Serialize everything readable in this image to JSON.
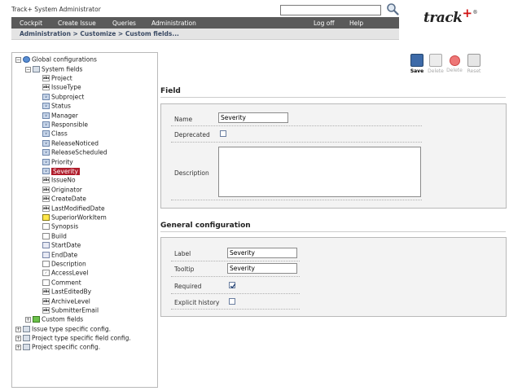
{
  "header": {
    "user_line": "Track+ System Administrator",
    "search": {
      "value": "",
      "placeholder": ""
    },
    "logo_text": "track",
    "logo_plus": "+",
    "logo_reg": "®"
  },
  "menu": {
    "items": [
      "Cockpit",
      "Create Issue",
      "Queries",
      "Administration",
      "Log off",
      "Help"
    ]
  },
  "breadcrumb": "Administration  >  Customize  >  Custom fields...",
  "toolbar": {
    "buttons": [
      {
        "label": "Save",
        "enabled": true
      },
      {
        "label": "Delete",
        "enabled": false
      },
      {
        "label": "Delete",
        "enabled": false
      },
      {
        "label": "Reset",
        "enabled": false
      }
    ]
  },
  "tree": {
    "root": "Global configurations",
    "system_fields": "System fields",
    "items": [
      {
        "label": "Project",
        "icon": "abc"
      },
      {
        "label": "IssueType",
        "icon": "abc"
      },
      {
        "label": "Subproject",
        "icon": "select"
      },
      {
        "label": "Status",
        "icon": "select"
      },
      {
        "label": "Manager",
        "icon": "select"
      },
      {
        "label": "Responsible",
        "icon": "select"
      },
      {
        "label": "Class",
        "icon": "select"
      },
      {
        "label": "ReleaseNoticed",
        "icon": "select"
      },
      {
        "label": "ReleaseScheduled",
        "icon": "select"
      },
      {
        "label": "Priority",
        "icon": "select"
      },
      {
        "label": "Severity",
        "icon": "select",
        "selected": true
      },
      {
        "label": "IssueNo",
        "icon": "abc"
      },
      {
        "label": "Originator",
        "icon": "abc"
      },
      {
        "label": "CreateDate",
        "icon": "abc"
      },
      {
        "label": "LastModifiedDate",
        "icon": "abc"
      },
      {
        "label": "SuperiorWorkItem",
        "icon": "parent"
      },
      {
        "label": "Synopsis",
        "icon": "plain"
      },
      {
        "label": "Build",
        "icon": "plain"
      },
      {
        "label": "StartDate",
        "icon": "date"
      },
      {
        "label": "EndDate",
        "icon": "date"
      },
      {
        "label": "Description",
        "icon": "plain"
      },
      {
        "label": "AccessLevel",
        "icon": "check"
      },
      {
        "label": "Comment",
        "icon": "plain"
      },
      {
        "label": "LastEditedBy",
        "icon": "abc"
      },
      {
        "label": "ArchiveLevel",
        "icon": "abc"
      },
      {
        "label": "SubmitterEmail",
        "icon": "abc"
      }
    ],
    "custom_fields": "Custom fields",
    "other_roots": [
      "Issue type specific config.",
      "Project type specific field config.",
      "Project specific config."
    ]
  },
  "field": {
    "title": "Field",
    "name_label": "Name",
    "name_value": "Severity",
    "deprecated_label": "Deprecated",
    "deprecated_checked": false,
    "description_label": "Description",
    "description_value": ""
  },
  "general": {
    "title": "General configuration",
    "label_label": "Label",
    "label_value": "Severity",
    "tooltip_label": "Tooltip",
    "tooltip_value": "Severity",
    "required_label": "Required",
    "required_checked": true,
    "explicit_history_label": "Explicit history",
    "explicit_history_checked": false
  }
}
